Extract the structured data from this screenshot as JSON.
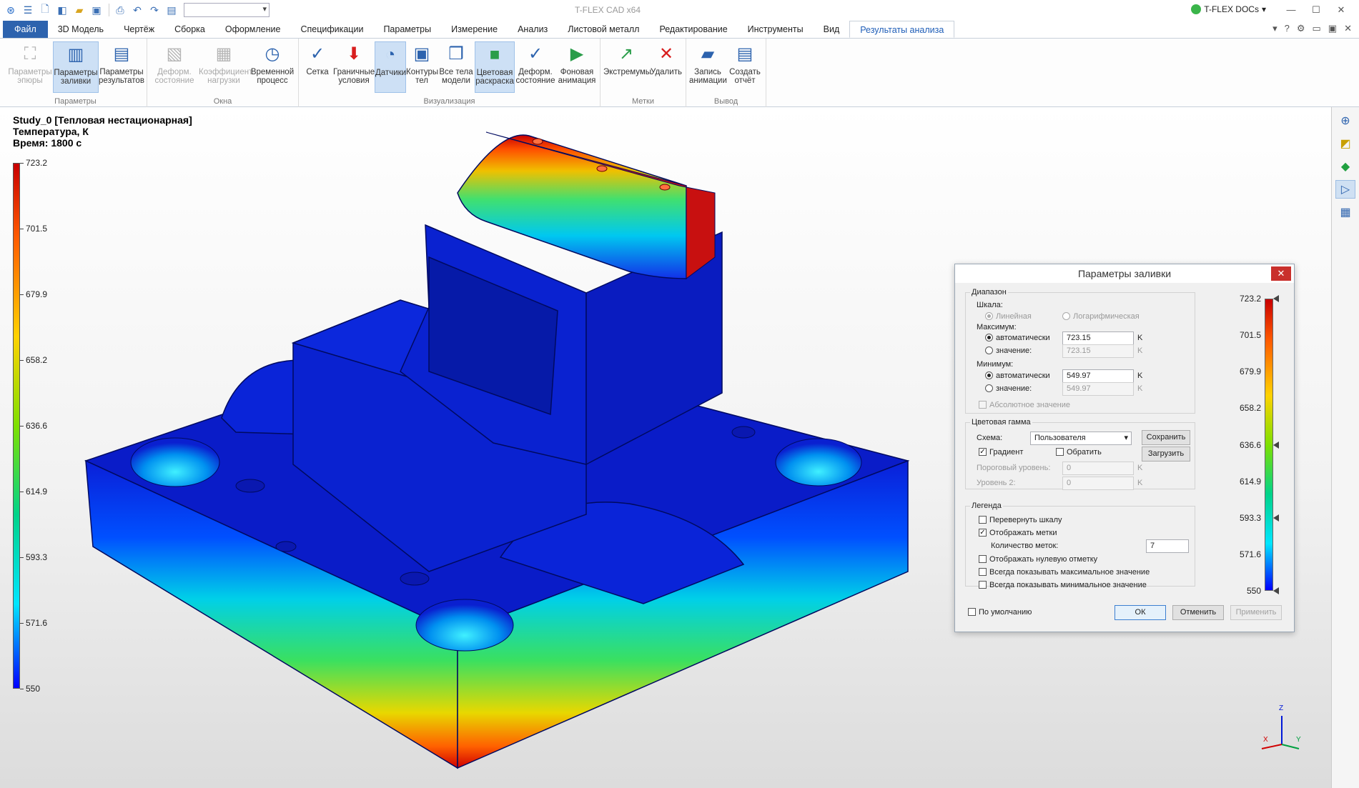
{
  "app": {
    "title": "T-FLEX CAD x64",
    "docs_label": "T-FLEX DOCs"
  },
  "window": {
    "minimize": "—",
    "maximize": "☐",
    "close": "✕"
  },
  "quick_access": {
    "icons": [
      "app-menu-icon",
      "hamburger-icon",
      "new-file-icon",
      "cube-icon",
      "open-folder-icon",
      "save-icon",
      "print-icon",
      "undo-icon",
      "redo-icon",
      "doc-icon"
    ],
    "combo_value": ""
  },
  "menu": {
    "tabs": [
      "Файл",
      "3D Модель",
      "Чертёж",
      "Сборка",
      "Оформление",
      "Спецификации",
      "Параметры",
      "Измерение",
      "Анализ",
      "Листовой металл",
      "Редактирование",
      "Инструменты",
      "Вид",
      "Результаты анализа"
    ],
    "active": "Результаты анализа"
  },
  "ribbon": {
    "groups": [
      {
        "label": "Параметры",
        "buttons": [
          {
            "label": "Параметры эпюры",
            "icon": "plot-params-icon",
            "state": "disabled"
          },
          {
            "label": "Параметры заливки",
            "icon": "fill-params-icon",
            "state": "selected"
          },
          {
            "label": "Параметры результатов",
            "icon": "result-params-icon",
            "state": "normal"
          }
        ]
      },
      {
        "label": "Окна",
        "buttons": [
          {
            "label": "Деформ. состояние",
            "icon": "deform-state-icon",
            "state": "disabled"
          },
          {
            "label": "Коэффициент нагрузки",
            "icon": "load-factor-icon",
            "state": "disabled"
          },
          {
            "label": "Временной процесс",
            "icon": "time-process-icon",
            "state": "normal"
          }
        ]
      },
      {
        "label": "Визуализация",
        "buttons": [
          {
            "label": "Сетка",
            "icon": "mesh-icon",
            "state": "normal"
          },
          {
            "label": "Граничные условия",
            "icon": "boundary-conditions-icon",
            "state": "normal"
          },
          {
            "label": "Датчики",
            "icon": "sensors-icon",
            "state": "selected"
          },
          {
            "label": "Контуры тел",
            "icon": "body-contours-icon",
            "state": "normal"
          },
          {
            "label": "Все тела модели",
            "icon": "all-bodies-icon",
            "state": "normal"
          },
          {
            "label": "Цветовая раскраска",
            "icon": "color-fill-icon",
            "state": "selected"
          },
          {
            "label": "Деформ. состояние",
            "icon": "deformed-state-icon",
            "state": "normal"
          },
          {
            "label": "Фоновая анимация",
            "icon": "background-animation-icon",
            "state": "normal"
          }
        ]
      },
      {
        "label": "Метки",
        "buttons": [
          {
            "label": "Экстремумы",
            "icon": "extremes-icon",
            "state": "normal"
          },
          {
            "label": "Удалить",
            "icon": "delete-icon",
            "state": "normal"
          }
        ]
      },
      {
        "label": "Вывод",
        "buttons": [
          {
            "label": "Запись анимации",
            "icon": "record-animation-icon",
            "state": "normal"
          },
          {
            "label": "Создать отчёт",
            "icon": "create-report-icon",
            "state": "normal"
          }
        ]
      }
    ]
  },
  "study": {
    "name": "Study_0 [Тепловая нестационарная]",
    "quantity": "Температура, К",
    "time": "Время: 1800 с"
  },
  "legend": {
    "ticks": [
      "723.2",
      "701.5",
      "679.9",
      "658.2",
      "636.6",
      "614.9",
      "593.3",
      "571.6",
      "550"
    ]
  },
  "dialog": {
    "title": "Параметры заливки",
    "range": {
      "label": "Диапазон",
      "scale_label": "Шкала:",
      "linear": "Линейная",
      "log": "Логарифмическая",
      "max_label": "Максимум:",
      "max_auto": "автоматически",
      "max_auto_value": "723.15",
      "max_value_label": "значение:",
      "max_value": "723.15",
      "min_label": "Минимум:",
      "min_auto": "автоматически",
      "min_auto_value": "549.97",
      "min_value_label": "значение:",
      "min_value": "549.97",
      "unit": "K",
      "absolute": "Абсолютное значение"
    },
    "gamma": {
      "label": "Цветовая гамма",
      "scheme_label": "Схема:",
      "scheme_value": "Пользователя",
      "save": "Сохранить",
      "load": "Загрузить",
      "gradient": "Градиент",
      "invert": "Обратить",
      "threshold_label": "Пороговый уровень:",
      "threshold_value": "0",
      "level2_label": "Уровень 2:",
      "level2_value": "0",
      "unit": "K"
    },
    "legend_group": {
      "label": "Легенда",
      "flip": "Перевернуть шкалу",
      "show_marks": "Отображать метки",
      "count_label": "Количество меток:",
      "count_value": "7",
      "zero_mark": "Отображать нулевую отметку",
      "show_max": "Всегда показывать максимальное значение",
      "show_min": "Всегда показывать минимальное значение"
    },
    "default_label": "По умолчанию",
    "ok": "ОК",
    "cancel": "Отменить",
    "apply": "Применить",
    "scale_values": [
      "723.2",
      "701.5",
      "679.9",
      "658.2",
      "636.6",
      "614.9",
      "593.3",
      "571.6",
      "550"
    ]
  },
  "triad": {
    "x": "X",
    "y": "Y",
    "z": "Z"
  },
  "colors": {
    "accent": "#2d63ae",
    "hot": "#c80000",
    "cold": "#0000ff",
    "close": "#c9302c"
  }
}
